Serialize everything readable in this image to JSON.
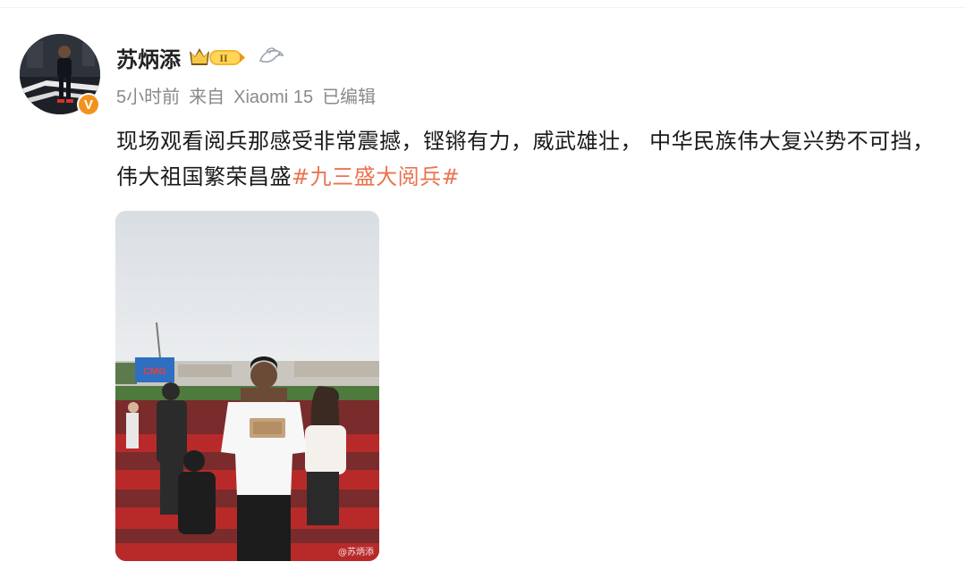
{
  "user": {
    "name": "苏炳添",
    "verified_mark": "V",
    "level_text": "II"
  },
  "meta": {
    "time": "5小时前",
    "source_prefix": "来自",
    "device": "Xiaomi 15",
    "edited": "已编辑"
  },
  "post": {
    "text": "现场观看阅兵那感受非常震撼，铿锵有力，威武雄壮， 中华民族伟大复兴势不可挡，伟大祖国繁荣昌盛",
    "hashtag": "#九三盛大阅兵#"
  },
  "image": {
    "screen_text": "CMG",
    "watermark": "@苏炳添"
  },
  "icons": {
    "level_badge": "crown-level-badge-icon",
    "fan_badge": "bird-icon",
    "verified": "verified-v-icon"
  },
  "colors": {
    "hashtag": "#eb7350",
    "verified_badge": "#f2921d",
    "meta_text": "#8a8a8a"
  }
}
